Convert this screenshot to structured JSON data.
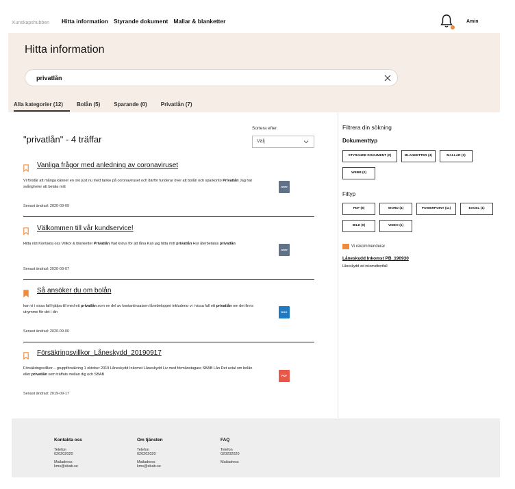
{
  "header": {
    "logo": "Kunskapshubben",
    "nav": [
      "Hitta information",
      "Styrande dokument",
      "Mallar & blanketter"
    ],
    "user": "Amin",
    "accent": "#f08a3c"
  },
  "hero": {
    "title": "Hitta information",
    "search_value": "privatlån",
    "bg": "#f6ede6"
  },
  "tabs": [
    {
      "label": "Alla kategorier (12)",
      "active": true
    },
    {
      "label": "Bolån (5)",
      "active": false
    },
    {
      "label": "Sparande (0)",
      "active": false
    },
    {
      "label": "Privatlån (7)",
      "active": false
    }
  ],
  "results": {
    "title": "\"privatlån\" - 4 träffar",
    "sort_label": "Sortera efter",
    "sort_value": "Välj",
    "items": [
      {
        "title": "Vanliga frågor med anledning av coronaviruset",
        "snippet_html": "Vi förstår att många känner en oro just nu med tanke på coronaviruset och därför funderar över att bolån och sparkonto <b>Privatlån</b> Jag har svårigheter att betala mitt",
        "date": "Senast ändrad: 2020-09-09",
        "file": "www",
        "bookmarked": false
      },
      {
        "title": "Välkommen till vår kundservice!",
        "snippet_html": "Hitta rätt Kontakta oss Villkor & blanketter <b>Privatlån</b> Vad krävs för att låna Kan jag hitta mitt <b>privatlån</b> Hur återbetalas <b>privatlån</b>",
        "date": "Senast ändrad: 2020-09-07",
        "file": "www",
        "bookmarked": false
      },
      {
        "title": "Så ansöker du om bolån",
        "snippet_html": "kan vi i vissa fall hjälpa till med ett <b>privatlån</b> som en del av kontantinsatsen lånebeloppet inkluderar vi i vissa fall ett <b>privatlån</b> om det finns utrymme för det i din",
        "date": "Senast ändrad: 2020-09-06",
        "file": "DOC",
        "bookmarked": true
      },
      {
        "title": "Försäkringsvillkor_Låneskydd_20190917",
        "snippet_html": "Försäkringsvillkor – gruppförsäkring 1 oktober 2019 Låneskydd Inkomst Låneskydd Liv med förmånstagare SBAB Lån Det avtal om bolån eller <b>privatlån</b> som träffats mellan dig och SBAB",
        "date": "Senast ändrad: 2019-09-17",
        "file": "PDF",
        "bookmarked": false
      }
    ]
  },
  "filters": {
    "title": "Filtrera din sökning",
    "doctype_title": "Dokumenttyp",
    "doctypes": [
      "STYRANDE DOKUMENT (0)",
      "BLANKETTER (4)",
      "MALLAR (2)",
      "WEBB (0)"
    ],
    "filetype_title": "Filtyp",
    "filetypes": [
      "PDF (8)",
      "WORD (4)",
      "POWERPOINT (11)",
      "EXCEL (1)",
      "BILD (0)",
      "VIDEO (1)"
    ],
    "rec_label": "Vi rekommenderar",
    "rec_link": "Låneskydd Inkomst PB_190930",
    "rec_sub": "Låneskydd vid inkomstbortfall"
  },
  "footer": {
    "cols": [
      {
        "title": "Kontakta oss",
        "phone_label": "Telefon",
        "phone": "020202020",
        "mail_label": "Mailadress",
        "mail": "kms@sbab.se"
      },
      {
        "title": "Om tjänsten",
        "phone_label": "Telefon",
        "phone": "020202020",
        "mail_label": "Mailadress",
        "mail": "kms@sbab.se"
      },
      {
        "title": "FAQ",
        "phone_label": "Telefon",
        "phone": "020202020",
        "mail_label": "Mailadress",
        "mail": ""
      }
    ]
  },
  "file_colors": {
    "www": "#5f7287",
    "DOC": "#1f7ac4",
    "PDF": "#e8584a"
  }
}
